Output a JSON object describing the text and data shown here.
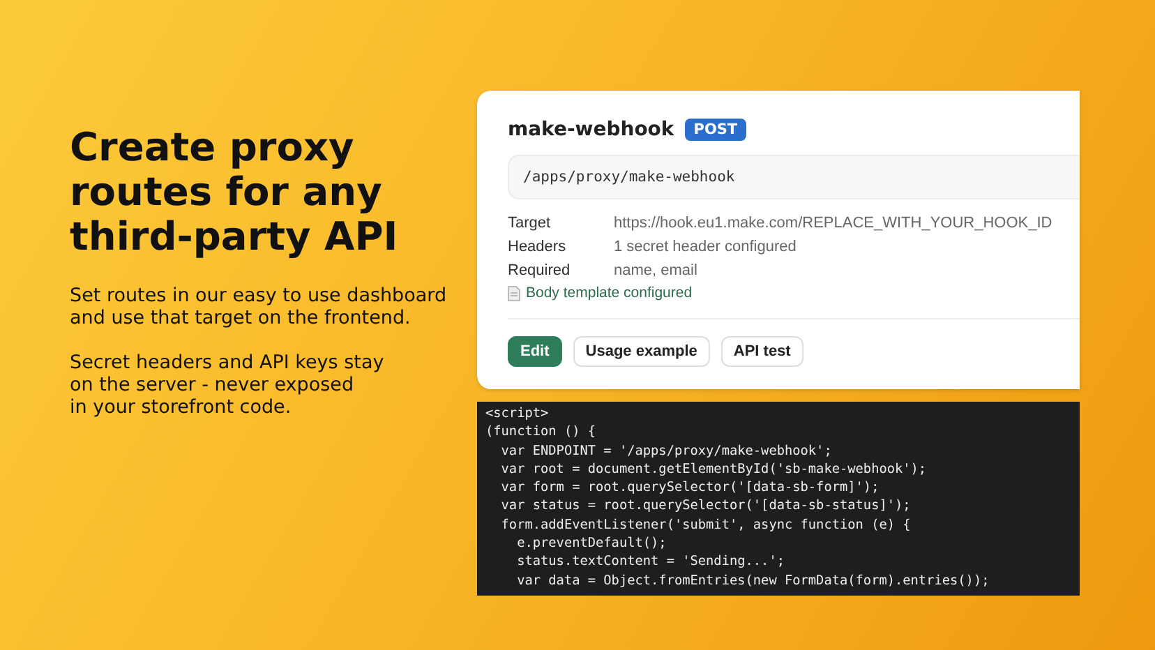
{
  "headline": {
    "lines": [
      "Create proxy",
      "routes for any",
      "third-party API"
    ]
  },
  "paragraphs": [
    {
      "lines": [
        "Set routes in our easy to use dashboard",
        "and use that target on the frontend."
      ]
    },
    {
      "lines": [
        "Secret headers and API keys stay",
        "on the server - never exposed",
        "in your storefront code."
      ]
    }
  ],
  "route_card": {
    "name": "make-webhook",
    "method": "POST",
    "path": "/apps/proxy/make-webhook",
    "details": [
      {
        "label": "Target",
        "value": "https://hook.eu1.make.com/REPLACE_WITH_YOUR_HOOK_ID"
      },
      {
        "label": "Headers",
        "value": "1 secret header configured"
      },
      {
        "label": "Required",
        "value": "name, email"
      }
    ],
    "body_note": "Body template configured",
    "buttons": [
      {
        "label": "Edit",
        "kind": "primary"
      },
      {
        "label": "Usage example",
        "kind": "secondary"
      },
      {
        "label": "API test",
        "kind": "secondary"
      }
    ]
  },
  "code": {
    "lines": [
      "<script>",
      "(function () {",
      "  var ENDPOINT = '/apps/proxy/make-webhook';",
      "  var root = document.getElementById('sb-make-webhook');",
      "  var form = root.querySelector('[data-sb-form]');",
      "  var status = root.querySelector('[data-sb-status]');",
      "  form.addEventListener('submit', async function (e) {",
      "    e.preventDefault();",
      "    status.textContent = 'Sending...';",
      "    var data = Object.fromEntries(new FormData(form).entries());"
    ]
  }
}
